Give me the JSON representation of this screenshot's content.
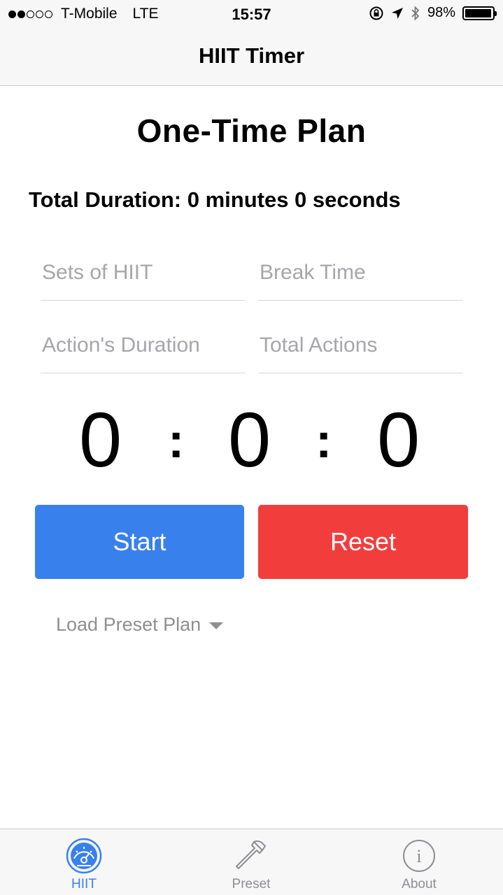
{
  "status_bar": {
    "carrier": "T-Mobile",
    "network": "LTE",
    "time": "15:57",
    "battery": "98%",
    "battery_level": 0.98,
    "signal_bars": 2,
    "icons": [
      "rotation-lock-icon",
      "location-arrow-icon",
      "bluetooth-icon"
    ]
  },
  "nav": {
    "title": "HIIT Timer"
  },
  "main": {
    "plan_title": "One-Time Plan",
    "total_duration": "Total Duration: 0 minutes 0 seconds",
    "fields": {
      "sets_placeholder": "Sets of HIIT",
      "break_placeholder": "Break Time",
      "action_duration_placeholder": "Action's Duration",
      "total_actions_placeholder": "Total Actions"
    },
    "timer": {
      "minutes": "0",
      "seconds": "0",
      "third": "0",
      "separator": ":"
    },
    "start_label": "Start",
    "reset_label": "Reset",
    "load_preset_label": "Load Preset Plan"
  },
  "tabs": [
    {
      "label": "HIIT",
      "icon": "speedometer-icon",
      "active": true
    },
    {
      "label": "Preset",
      "icon": "hammer-icon",
      "active": false
    },
    {
      "label": "About",
      "icon": "info-icon",
      "active": false
    }
  ],
  "colors": {
    "accent": "#3880ec",
    "danger": "#f23d3d",
    "placeholder": "#a6a6ab",
    "bar_bg": "#f7f7f7"
  }
}
